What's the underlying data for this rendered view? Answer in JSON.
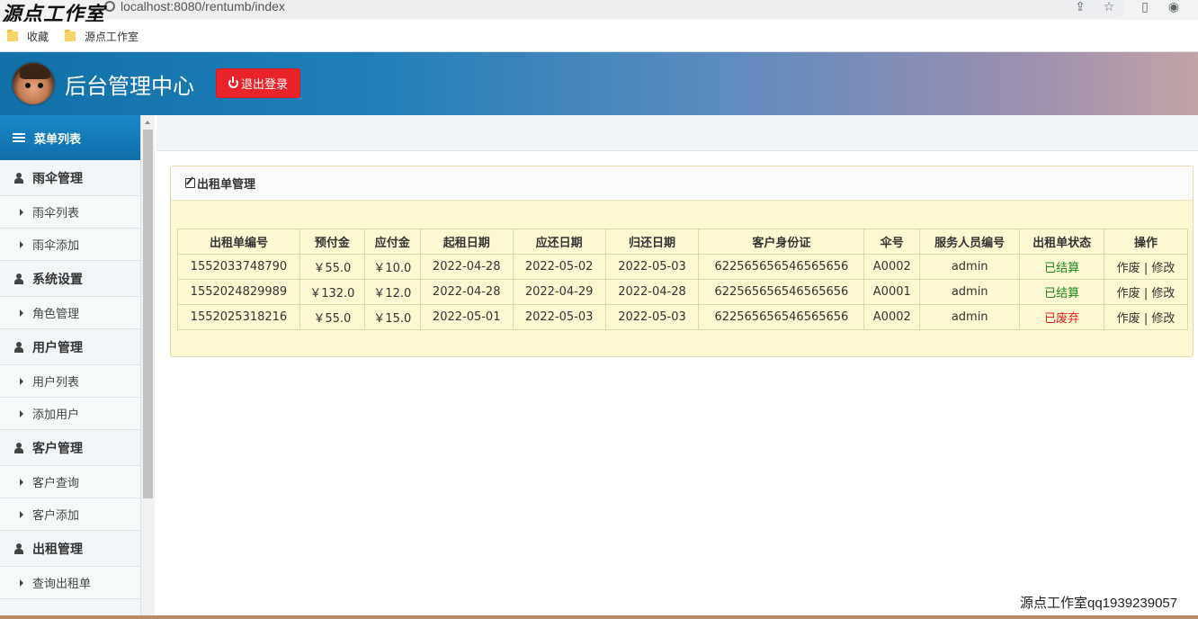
{
  "browser": {
    "url": "localhost:8080/rentumb/index",
    "bookmarks": [
      "收藏",
      "源点工作室"
    ]
  },
  "watermark_top": "源点工作室",
  "header": {
    "title": "后台管理中心",
    "logout_label": "退出登录"
  },
  "sidebar": {
    "title": "菜单列表",
    "groups": [
      {
        "label": "雨伞管理",
        "items": [
          "雨伞列表",
          "雨伞添加"
        ]
      },
      {
        "label": "系统设置",
        "items": [
          "角色管理"
        ]
      },
      {
        "label": "用户管理",
        "items": [
          "用户列表",
          "添加用户"
        ]
      },
      {
        "label": "客户管理",
        "items": [
          "客户查询",
          "客户添加"
        ]
      },
      {
        "label": "出租管理",
        "items": [
          "查询出租单"
        ]
      }
    ]
  },
  "panel": {
    "title": "出租单管理",
    "columns": [
      "出租单编号",
      "预付金",
      "应付金",
      "起租日期",
      "应还日期",
      "归还日期",
      "客户身份证",
      "伞号",
      "服务人员编号",
      "出租单状态",
      "操作"
    ],
    "rows": [
      {
        "id": "1552033748790",
        "prepay": "￥55.0",
        "due": "￥10.0",
        "start": "2022-04-28",
        "due_date": "2022-05-02",
        "return_date": "2022-05-03",
        "id_card": "622565656546565656",
        "umbrella": "A0002",
        "staff": "admin",
        "status": "已结算",
        "status_color": "#1a8a1a"
      },
      {
        "id": "1552024829989",
        "prepay": "￥132.0",
        "due": "￥12.0",
        "start": "2022-04-28",
        "due_date": "2022-04-29",
        "return_date": "2022-04-28",
        "id_card": "622565656546565656",
        "umbrella": "A0001",
        "staff": "admin",
        "status": "已结算",
        "status_color": "#1a8a1a"
      },
      {
        "id": "1552025318216",
        "prepay": "￥55.0",
        "due": "￥15.0",
        "start": "2022-05-01",
        "due_date": "2022-05-03",
        "return_date": "2022-05-03",
        "id_card": "622565656546565656",
        "umbrella": "A0002",
        "staff": "admin",
        "status": "已废弃",
        "status_color": "#e02020"
      }
    ],
    "actions": {
      "void": "作废",
      "separator": "|",
      "edit": "修改"
    }
  },
  "watermark_bottom": "源点工作室qq1939239057"
}
